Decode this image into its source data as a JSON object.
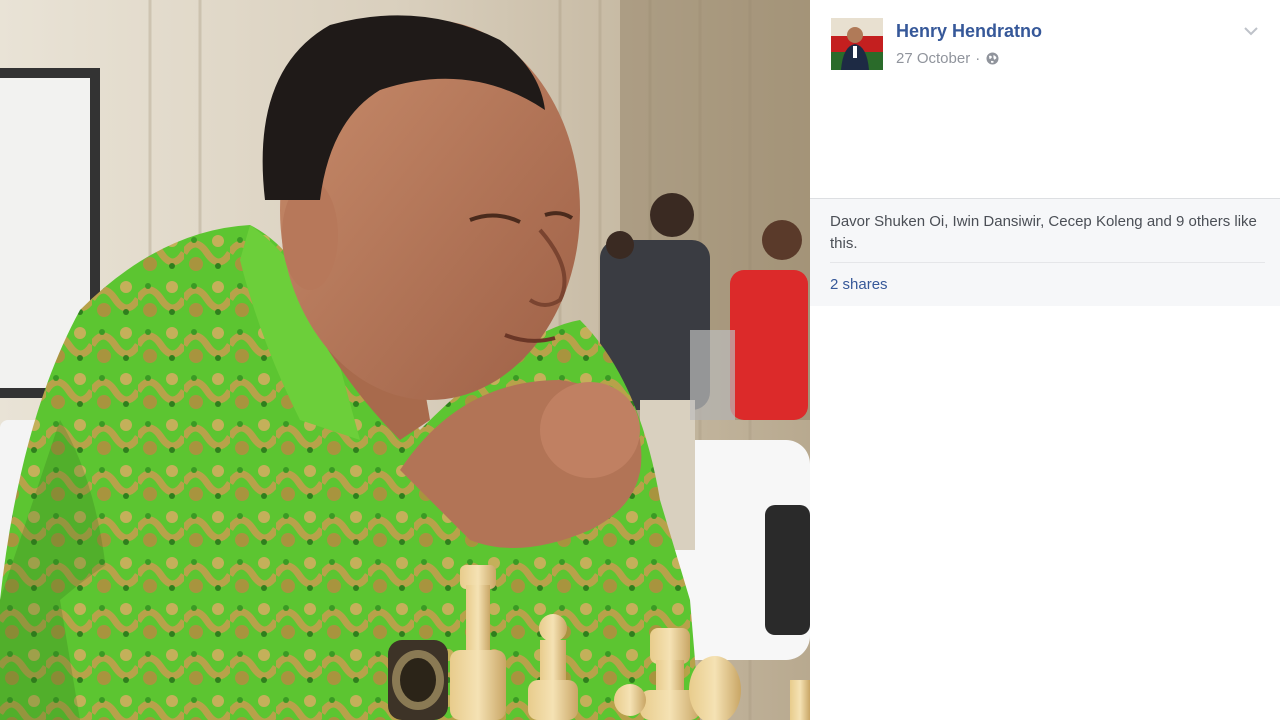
{
  "post": {
    "author_name": "Henry Hendratno",
    "date": "27 October",
    "separator": "·",
    "privacy_icon": "globe-icon",
    "options_icon": "chevron-down-icon"
  },
  "engagement": {
    "likes_text": "Davor Shuken Oi, Iwin Dansiwir, Cecep Koleng and 9 others like this.",
    "shares_text": "2 shares"
  },
  "photo": {
    "subject": "elderly man in green batik shirt at chess board"
  },
  "colors": {
    "link_blue": "#365899",
    "meta_gray": "#90949c",
    "panel_gray": "#f6f7f9",
    "batik_green": "#4cb82c"
  }
}
